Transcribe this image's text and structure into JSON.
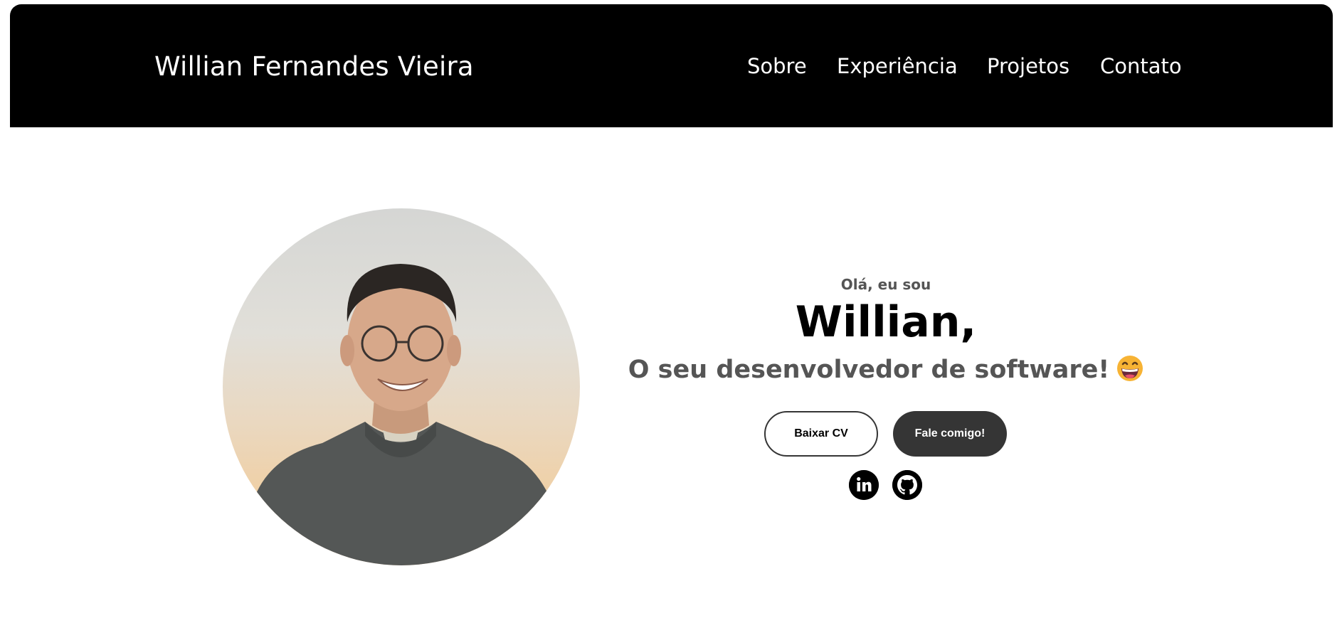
{
  "header": {
    "brand": "Willian Fernandes Vieira",
    "nav": [
      "Sobre",
      "Experiência",
      "Projetos",
      "Contato"
    ]
  },
  "hero": {
    "greeting": "Olá, eu sou",
    "name": "Willian,",
    "subtitle": "O seu desenvolvedor de software!",
    "emoji": "grinning-face-emoji",
    "buttons": {
      "download_cv": "Baixar CV",
      "contact_me": "Fale comigo!"
    },
    "social_icons": [
      "linkedin-icon",
      "github-icon"
    ]
  },
  "colors": {
    "navbar_bg": "#000000",
    "accent_dark": "#353535",
    "subtitle": "#555555"
  }
}
